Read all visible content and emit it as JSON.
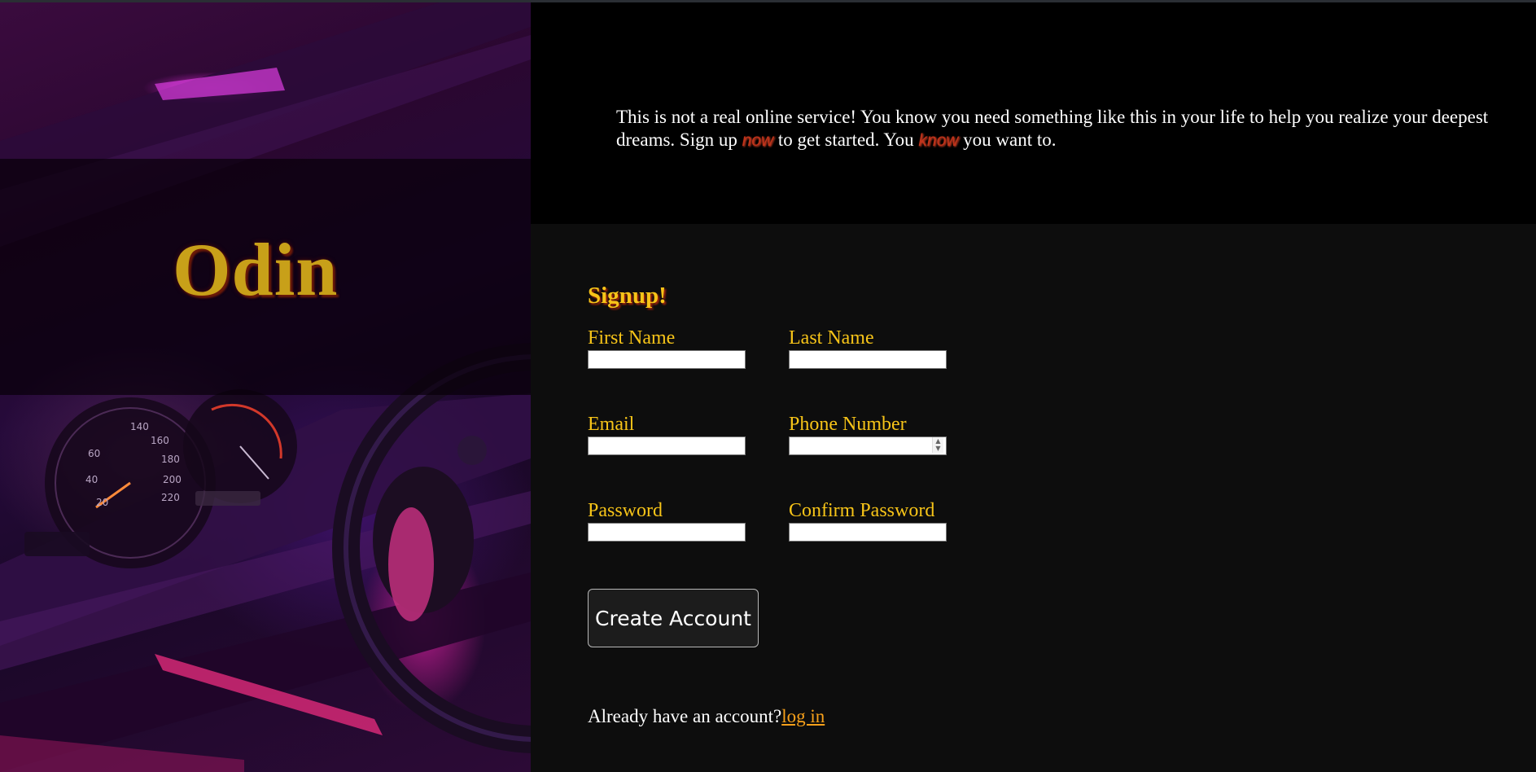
{
  "brand": {
    "name": "Odin"
  },
  "intro": {
    "part1": "This is not a real online service! You know you need something like this in your life to help you realize your deepest dreams. Sign up ",
    "emph1": "now",
    "part2": " to get started. You ",
    "emph2": "know",
    "part3": " you want to."
  },
  "form": {
    "title": "Signup!",
    "fields": {
      "first_name": {
        "label": "First Name",
        "value": ""
      },
      "last_name": {
        "label": "Last Name",
        "value": ""
      },
      "email": {
        "label": "Email",
        "value": ""
      },
      "phone": {
        "label": "Phone Number",
        "value": ""
      },
      "password": {
        "label": "Password",
        "value": ""
      },
      "confirm_password": {
        "label": "Confirm Password",
        "value": ""
      }
    },
    "submit_label": "Create Account",
    "login_prompt": "Already have an account?",
    "login_link": "log in"
  },
  "colors": {
    "accent": "#f7c418",
    "link": "#f7a01a",
    "emphasis": "#c0331a",
    "form_bg": "#0d0d0d",
    "intro_bg": "#000000"
  }
}
